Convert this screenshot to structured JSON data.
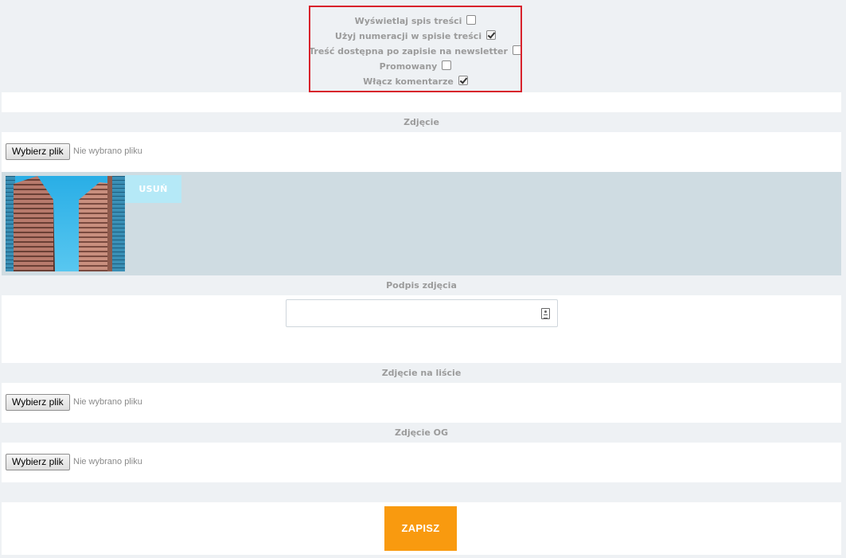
{
  "options": {
    "items": [
      {
        "label": "Wyświetlaj spis treści",
        "checked": false
      },
      {
        "label": "Użyj numeracji w spisie treści",
        "checked": true
      },
      {
        "label": "Treść dostępna po zapisie na newsletter",
        "checked": false
      },
      {
        "label": "Promowany",
        "checked": false
      },
      {
        "label": "Włącz komentarze",
        "checked": true
      }
    ]
  },
  "photo": {
    "label": "Zdjęcie",
    "file_button": "Wybierz plik",
    "file_status": "Nie wybrano pliku",
    "remove_label": "USUŃ"
  },
  "caption": {
    "label": "Podpis zdjęcia",
    "value": ""
  },
  "list_photo": {
    "label": "Zdjęcie na liście",
    "file_button": "Wybierz plik",
    "file_status": "Nie wybrano pliku"
  },
  "og_photo": {
    "label": "Zdjęcie OG",
    "file_button": "Wybierz plik",
    "file_status": "Nie wybrano pliku"
  },
  "save_label": "ZAPISZ",
  "colors": {
    "accent": "#f99a0f",
    "remove_bg": "#b5e9f7",
    "highlight": "#d8222b",
    "preview_bg": "#cfdce2"
  }
}
